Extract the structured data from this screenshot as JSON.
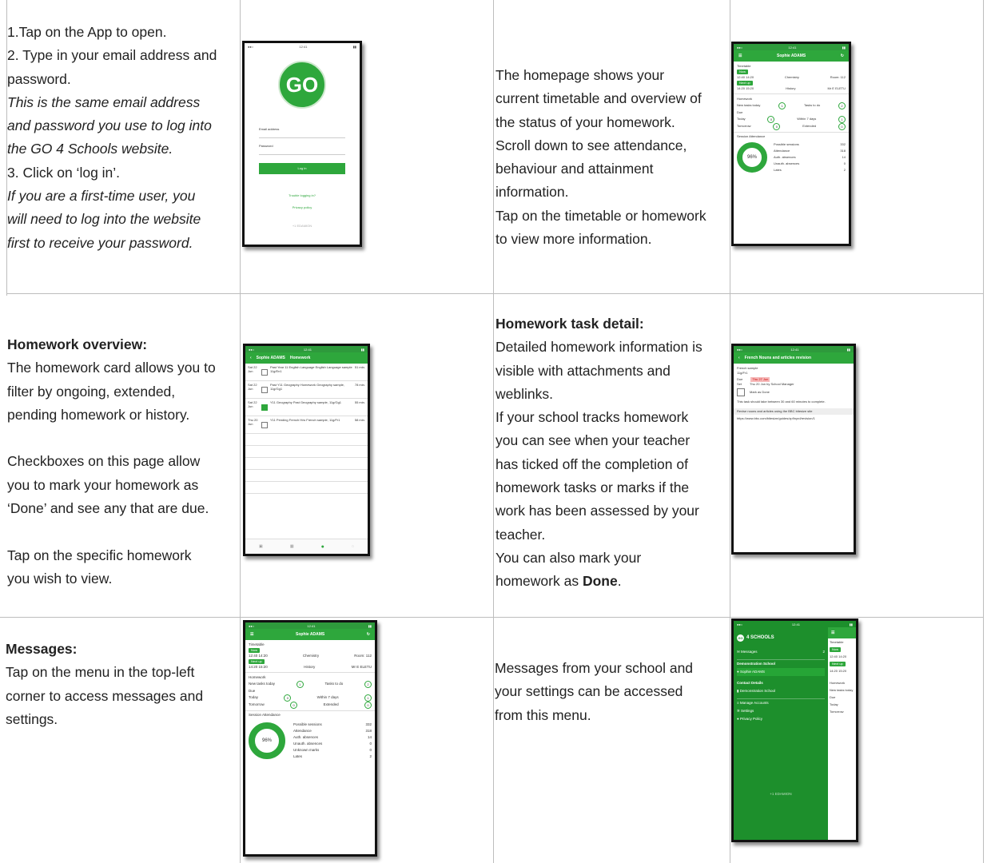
{
  "row1": {
    "left_lines": [
      "1.Tap on the App to open.",
      "2. Type in your email address and",
      "password.",
      "This is the same email address",
      "and password you use to log into",
      "the GO 4 Schools website.",
      "3. Click on ‘log in’.",
      "If you are a first-time user, you",
      "will need to log into the website",
      "first to receive your password."
    ],
    "right_lines": [
      "The homepage shows your",
      "current timetable and overview of",
      "the status of your homework.",
      "Scroll down to see attendance,",
      "behaviour and attainment",
      "information.",
      "Tap on the timetable or homework",
      "to view more information."
    ]
  },
  "row2": {
    "left_heading": "Homework overview:",
    "left_lines": [
      "The homework card allows you to",
      "filter by ongoing, extended,",
      "pending homework or history."
    ],
    "left_lines2": [
      "Checkboxes on this page allow",
      "you to mark your homework as",
      "‘Done’ and see any that are due."
    ],
    "left_lines3": [
      "Tap on the specific homework",
      "you wish to view."
    ],
    "right_heading": "Homework task detail:",
    "right_lines": [
      "Detailed homework information is",
      "visible with attachments and",
      "weblinks.",
      "If your school tracks homework",
      "you can see when your teacher",
      "has ticked off the completion of",
      "homework tasks or marks if the",
      "work has been assessed by your",
      "teacher.",
      "You can also mark your"
    ],
    "right_last_prefix": "homework as ",
    "right_last_bold": "Done",
    "right_last_suffix": "."
  },
  "row3": {
    "left_heading": "Messages:",
    "left_lines": [
      "Tap on the menu in the top-left",
      "corner to access messages and",
      "settings."
    ],
    "right_lines": [
      "Messages from your school and",
      "your settings can be accessed",
      "from this menu."
    ]
  },
  "login_screen": {
    "logo": "GO",
    "email_label": "Email address",
    "password_label": "Password",
    "login_button": "Log in",
    "trouble_link": "Trouble logging in?",
    "privacy_link": "Privacy policy",
    "footer": "+1 EDAMION"
  },
  "home_screen": {
    "title": "Sophie ADAMS",
    "timetable_label": "Timetable",
    "now_badge": "Now",
    "next_badge": "Next up",
    "lesson1_time": "12:40 14:20",
    "lesson1_subject": "Chemistry",
    "lesson1_group": "11W/Ch",
    "lesson1_room": "Room: 112",
    "lesson2_time": "14:20 15:20",
    "lesson2_subject": "History",
    "lesson2_group": "11W/H2",
    "lesson2_teacher": "Mr E ELETU",
    "lesson2_room": "Room: G17",
    "homework_label": "Homework",
    "new_tasks": "New tasks today",
    "new_tasks_count": "1",
    "tasks_todo": "Tasks to do",
    "tasks_todo_count": "2",
    "due_label": "Due",
    "today": "Today",
    "today_count": "0",
    "within7": "Within 7 days",
    "within7_count": "1",
    "tomorrow": "Tomorrow",
    "tomorrow_count": "0",
    "extended": "Extended",
    "extended_count": "0",
    "attendance_label": "Session Attendance",
    "attendance_pct": "96%",
    "possible_sessions": "Possible sessions",
    "possible_count": "332",
    "attendance_item": "Attendance",
    "attendance_count": "318",
    "auth_abs": "Auth. absences",
    "auth_count": "14",
    "unauth_abs": "Unauth. absences",
    "unauth_count": "0",
    "unknown_marks": "Unknown marks",
    "unknown_count": "0",
    "lates": "Lates",
    "lates_count": "2"
  },
  "homework_screen": {
    "back": "Sophie ADAMS",
    "title": "Homework",
    "items": [
      {
        "date": "Sat 22 Jun",
        "text": "Past Year 11 English Language English Language sample 11g/En1",
        "dur": "51 min."
      },
      {
        "date": "Sat 22 Jun",
        "text": "Past Y11 Geography Homework Geography sample, 11g/Gg1",
        "dur": "78 min."
      },
      {
        "date": "Sat 22 Jun",
        "text": "Y11 Geography Past Geography sample, 11g/Gg1",
        "dur": "55 min."
      },
      {
        "date": "Thu 20 Jun",
        "text": "Y11 Pending French H/w French sample, 11g/Fr1",
        "dur": "58 min."
      }
    ]
  },
  "detail_screen": {
    "title": "French Nouns and articles revision",
    "subject": "French sample",
    "group": "11g/Fr1",
    "due_label": "Due",
    "due_value": "Thu 27 Jun",
    "set_label": "Set",
    "set_value": "Thu 20 Jun by School Manager",
    "mark_done": "Mark as Done",
    "description": "This task should take between 30 and 60 minutes to complete.",
    "link_title": "Revise nouns and articles using the BBC bitesize site",
    "link_url": "https://www.bbc.com/bitesize/guides/zp9nyrd/revision/1"
  },
  "menu_screen": {
    "logo_text": "4 SCHOOLS",
    "messages": "Messages",
    "messages_count": "2",
    "school": "Demonstration School",
    "student": "Sophie ADAMS",
    "contact_details": "Contact Details",
    "contact_school": "Demonstration School",
    "manage_accounts": "Manage Accounts",
    "settings": "Settings",
    "privacy": "Privacy Policy",
    "footer": "+1 EDAMION"
  },
  "colors": {
    "green": "#2ea73c",
    "dark_green": "#1d8f2c",
    "grid": "#bdbdbd"
  }
}
